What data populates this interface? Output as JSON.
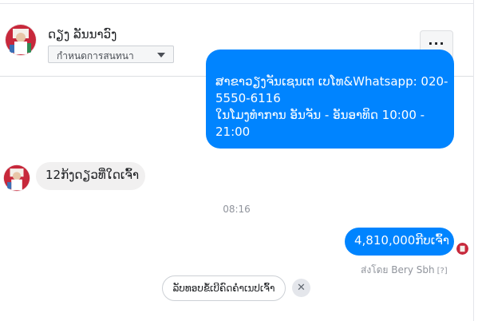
{
  "header": {
    "contact_name": "ດຽງ ລັນນາວົງ",
    "label_select": {
      "selected": "กำหนดการสนทนา"
    },
    "more_label": "···"
  },
  "messages": {
    "outgoing_info": {
      "lines": [
        "ສາຂາວຽງຈັນເຊນເຕ ເບໂທ&Whatsapp: 020-",
        "5550-6116",
        "ໃນໂມງທຳການ ອັນຈັນ - ອັນອາທິດ  10:00 -",
        "21:00"
      ]
    },
    "incoming": {
      "text": "12ກ້ງດຽວທີ່ໃດເຈົ້າ"
    },
    "timestamp": "08:16",
    "outgoing_price": {
      "text": "4,810,000ກີບເຈົ້າ"
    },
    "sent_by": {
      "text": "ส่งโดย Bery Sbh",
      "help": "[?]"
    }
  },
  "quick_reply": {
    "label": "ລັບທອບຂໍ້ເບີຄົດຄ່ຳເນປເຈົ້າ",
    "dismiss": "✕"
  },
  "colors": {
    "accent": "#0084ff",
    "incoming_bubble": "#f1f0f0",
    "muted_text": "#90949c"
  }
}
